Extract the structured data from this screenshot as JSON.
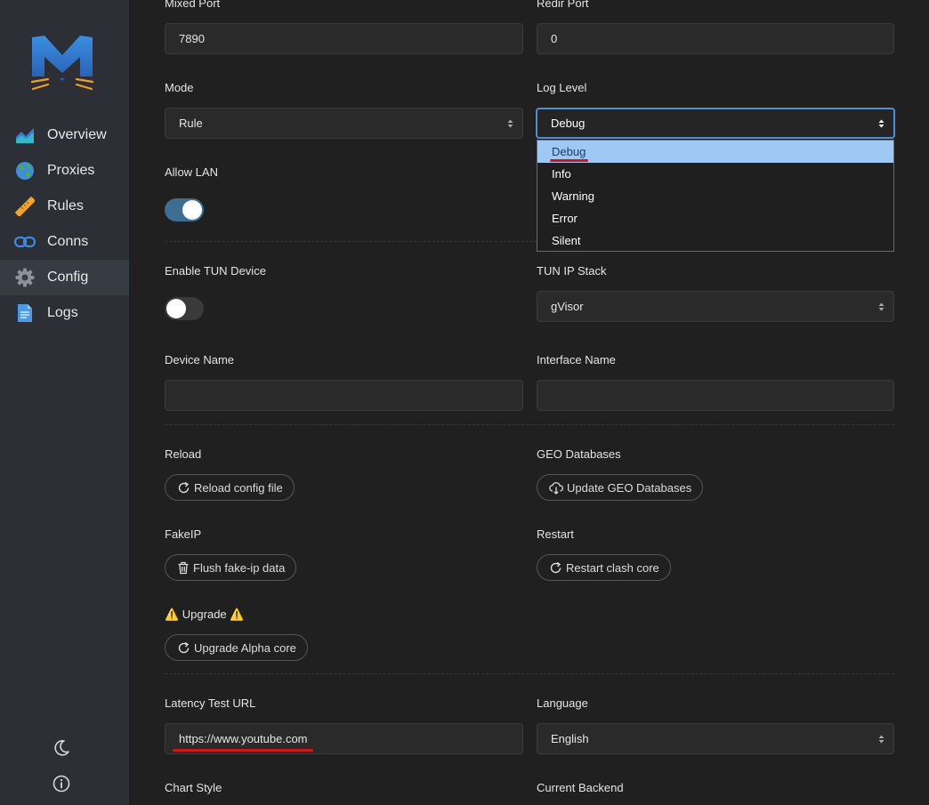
{
  "sidebar": {
    "items": [
      {
        "label": "Overview",
        "icon": "chart-icon"
      },
      {
        "label": "Proxies",
        "icon": "globe-icon"
      },
      {
        "label": "Rules",
        "icon": "ruler-icon"
      },
      {
        "label": "Conns",
        "icon": "link-icon"
      },
      {
        "label": "Config",
        "icon": "gear-icon",
        "active": true
      },
      {
        "label": "Logs",
        "icon": "document-icon"
      }
    ],
    "bottom_icons": [
      "moon-icon",
      "info-icon"
    ]
  },
  "config": {
    "mixed_port": {
      "label": "Mixed Port",
      "value": "7890"
    },
    "redir_port": {
      "label": "Redir Port",
      "value": "0"
    },
    "mode": {
      "label": "Mode",
      "value": "Rule"
    },
    "log_level": {
      "label": "Log Level",
      "value": "Debug",
      "options": [
        "Debug",
        "Info",
        "Warning",
        "Error",
        "Silent"
      ]
    },
    "allow_lan": {
      "label": "Allow LAN",
      "enabled": true
    },
    "enable_tun": {
      "label": "Enable TUN Device",
      "enabled": false
    },
    "tun_ip_stack": {
      "label": "TUN IP Stack",
      "value": "gVisor"
    },
    "device_name": {
      "label": "Device Name",
      "value": ""
    },
    "interface_name": {
      "label": "Interface Name",
      "value": ""
    },
    "reload": {
      "label": "Reload",
      "button": "Reload config file"
    },
    "geo_databases": {
      "label": "GEO Databases",
      "button": "Update GEO Databases"
    },
    "fakeip": {
      "label": "FakeIP",
      "button": "Flush fake-ip data"
    },
    "restart": {
      "label": "Restart",
      "button": "Restart clash core"
    },
    "upgrade": {
      "label": "⚠️ Upgrade ⚠️",
      "button": "Upgrade Alpha core"
    },
    "latency_test_url": {
      "label": "Latency Test URL",
      "value": "https://www.youtube.com"
    },
    "language": {
      "label": "Language",
      "value": "English"
    },
    "chart_style": {
      "label": "Chart Style"
    },
    "current_backend": {
      "label": "Current Backend"
    }
  },
  "colors": {
    "background": "#202020",
    "sidebar": "#2c2f36",
    "accent": "#3b6e91",
    "selected_option": "#9ec9f5",
    "annotation_red": "#d7141a"
  }
}
